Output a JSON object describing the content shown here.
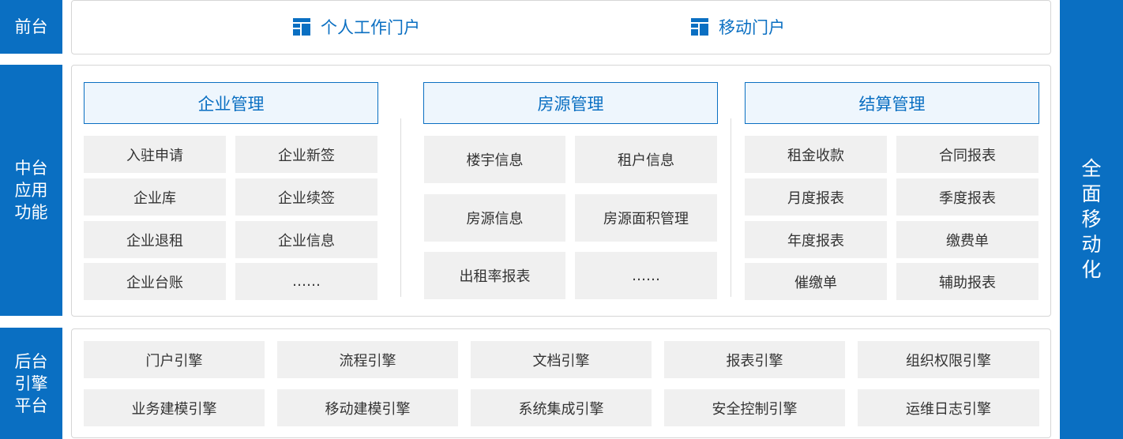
{
  "layers": {
    "front": "前台",
    "middle": "中台\n应用\n功能",
    "back": "后台\n引擎\n平台"
  },
  "right_bar": "全面移动化",
  "portals": [
    {
      "icon": "layout-icon",
      "label": "个人工作门户"
    },
    {
      "icon": "layout-icon",
      "label": "移动门户"
    }
  ],
  "groups": [
    {
      "title": "企业管理",
      "items": [
        "入驻申请",
        "企业新签",
        "企业库",
        "企业续签",
        "企业退租",
        "企业信息",
        "企业台账",
        "……"
      ]
    },
    {
      "title": "房源管理",
      "items": [
        "楼宇信息",
        "租户信息",
        "房源信息",
        "房源面积管理",
        "出租率报表",
        "……"
      ]
    },
    {
      "title": "结算管理",
      "items": [
        "租金收款",
        "合同报表",
        "月度报表",
        "季度报表",
        "年度报表",
        "缴费单",
        "催缴单",
        "辅助报表"
      ]
    }
  ],
  "engines": [
    [
      "门户引擎",
      "流程引擎",
      "文档引擎",
      "报表引擎",
      "组织权限引擎"
    ],
    [
      "业务建模引擎",
      "移动建模引擎",
      "系统集成引擎",
      "安全控制引擎",
      "运维日志引擎"
    ]
  ],
  "colors": {
    "accent": "#0a6fc2",
    "cell_bg": "#f0f0f0",
    "header_bg": "#eef6fd"
  }
}
